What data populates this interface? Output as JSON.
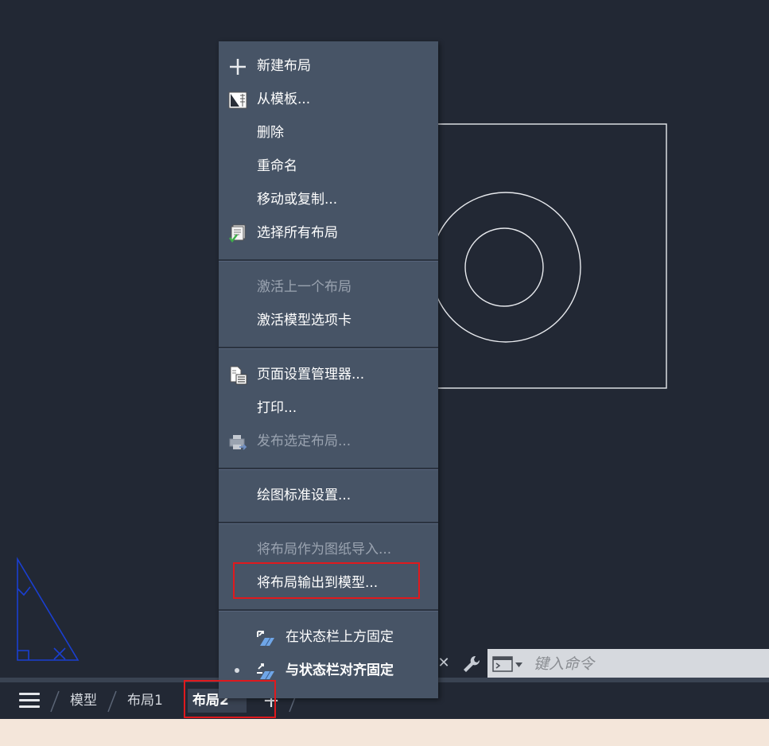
{
  "context_menu": {
    "items": [
      {
        "label": "新建布局",
        "icon": "plus-icon",
        "disabled": false
      },
      {
        "label": "从模板...",
        "icon": "template-icon",
        "disabled": false
      },
      {
        "label": "删除",
        "disabled": false
      },
      {
        "label": "重命名",
        "disabled": false
      },
      {
        "label": "移动或复制...",
        "disabled": false
      },
      {
        "label": "选择所有布局",
        "icon": "select-all-layouts-icon",
        "disabled": false
      },
      {
        "label": "激活上一个布局",
        "disabled": true
      },
      {
        "label": "激活模型选项卡",
        "disabled": false
      },
      {
        "label": "页面设置管理器...",
        "icon": "page-setup-icon",
        "disabled": false
      },
      {
        "label": "打印...",
        "disabled": false
      },
      {
        "label": "发布选定布局...",
        "icon": "publish-icon",
        "disabled": true
      },
      {
        "label": "绘图标准设置...",
        "disabled": false
      },
      {
        "label": "将布局作为图纸导入...",
        "disabled": true
      },
      {
        "label": "将布局输出到模型...",
        "disabled": false,
        "highlighted": true
      },
      {
        "label": "在状态栏上方固定",
        "icon": "pin-above-statusbar-icon",
        "disabled": false
      },
      {
        "label": "与状态栏对齐固定",
        "icon": "pin-aligned-statusbar-icon",
        "disabled": false,
        "checked": true
      }
    ]
  },
  "command_line": {
    "placeholder": "键入命令"
  },
  "layout_tabs": {
    "tabs": [
      {
        "label": "模型",
        "active": false
      },
      {
        "label": "布局1",
        "active": false
      },
      {
        "label": "布局2",
        "active": true
      }
    ],
    "add_label": "+"
  },
  "colors": {
    "canvas": "#222834",
    "menu_bg": "#475466",
    "highlight": "#e0191d",
    "ucs_icon": "#1a3fd1"
  }
}
